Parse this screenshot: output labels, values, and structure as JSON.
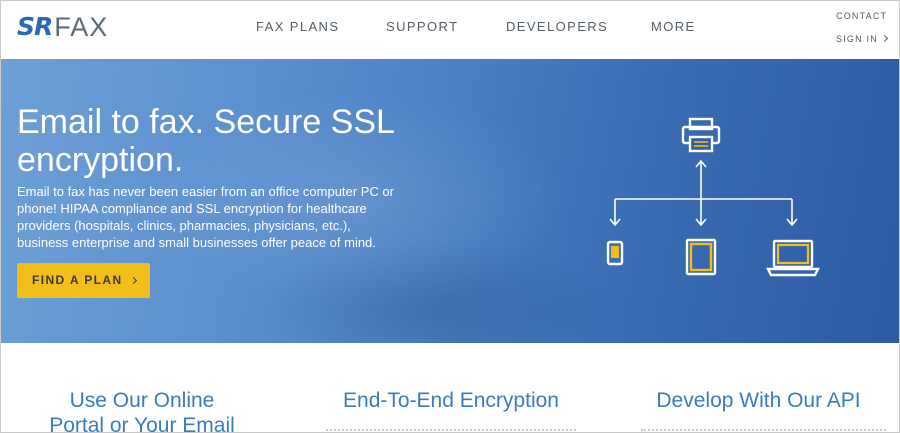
{
  "header": {
    "logo": {
      "mark": "SR",
      "word": "FAX"
    },
    "nav": [
      {
        "label": "FAX PLANS"
      },
      {
        "label": "SUPPORT"
      },
      {
        "label": "DEVELOPERS"
      },
      {
        "label": "MORE"
      }
    ],
    "utility": {
      "contact": "CONTACT",
      "sign_in": "SIGN IN"
    }
  },
  "hero": {
    "title": "Email to fax. Secure SSL encryption.",
    "description": "Email to fax has never been easier from an office computer PC or phone! HIPAA compliance and SSL encryption for healthcare providers (hospitals, clinics, pharmacies, physicians, etc.), business enterprise and small businesses offer peace of mind.",
    "cta_label": "FIND A PLAN",
    "icons": [
      "printer-icon",
      "phone-icon",
      "tablet-icon",
      "laptop-icon"
    ]
  },
  "features": [
    {
      "title_line1": "Use Our Online",
      "title_line2": "Portal or Your Email"
    },
    {
      "title_line1": "End-To-End Encryption"
    },
    {
      "title_line1": "Develop With Our API"
    }
  ],
  "colors": {
    "brand_blue": "#2a68b1",
    "accent_yellow": "#f2be1a",
    "heading_blue": "#3b7cc0"
  }
}
